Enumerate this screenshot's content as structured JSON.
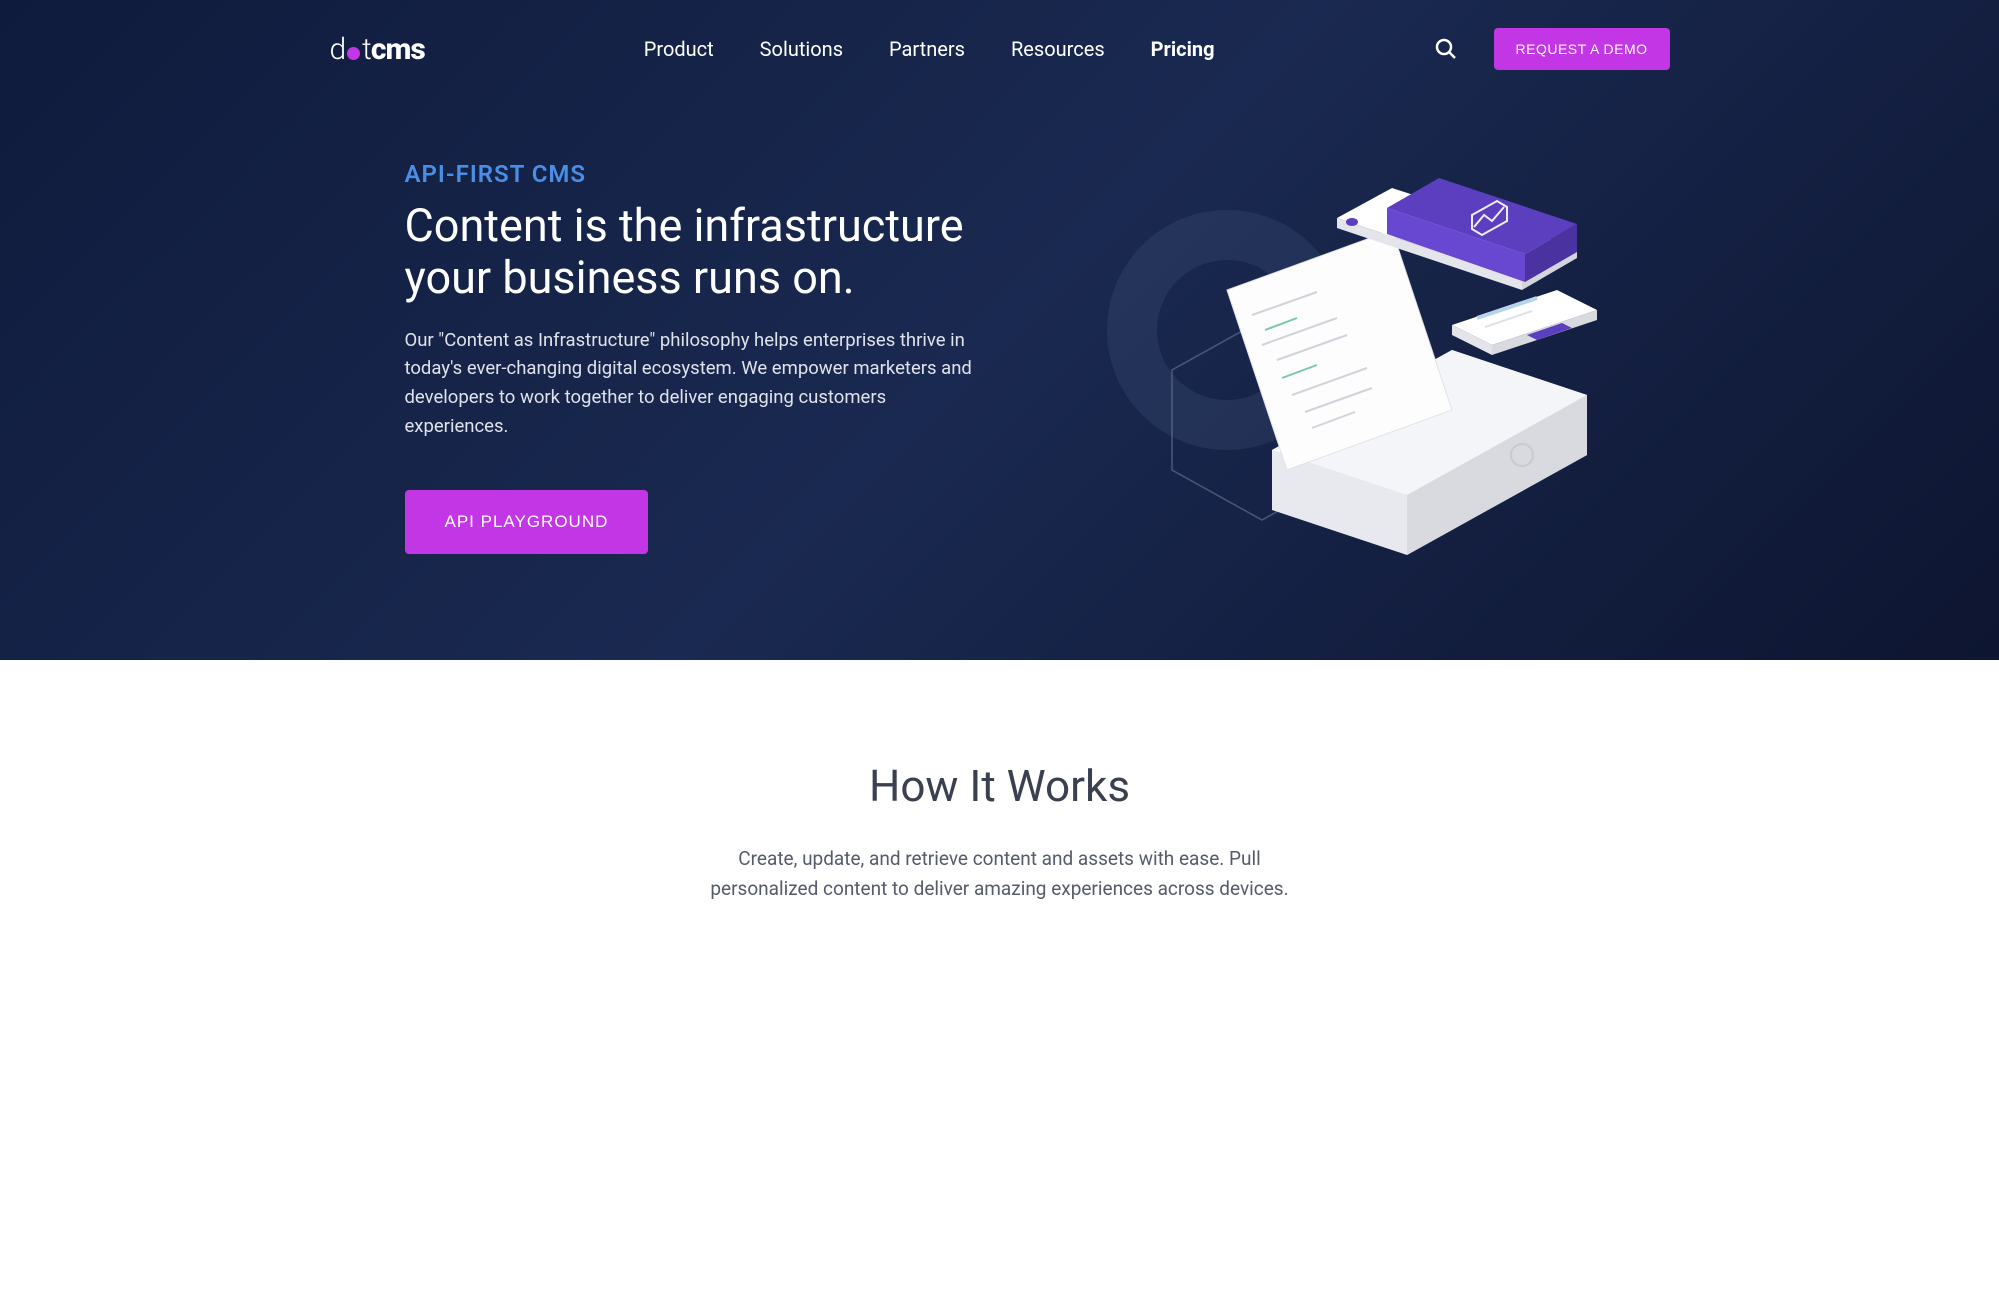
{
  "logo": {
    "prefix_d": "d",
    "prefix_t": "t",
    "suffix": "cms"
  },
  "nav": {
    "items": [
      {
        "label": "Product",
        "active": false
      },
      {
        "label": "Solutions",
        "active": false
      },
      {
        "label": "Partners",
        "active": false
      },
      {
        "label": "Resources",
        "active": false
      },
      {
        "label": "Pricing",
        "active": true
      }
    ],
    "demo_button": "REQUEST A DEMO"
  },
  "hero": {
    "eyebrow": "API-FIRST CMS",
    "title": "Content is the infrastructure your business runs on.",
    "description": "Our \"Content as Infrastructure\" philosophy helps enterprises thrive in today's ever-changing digital ecosystem. We empower marketers and developers to work together to deliver engaging customers experiences.",
    "cta_label": "API PLAYGROUND"
  },
  "section_two": {
    "title": "How It Works",
    "description": "Create, update, and retrieve content and assets with ease. Pull personalized content to deliver amazing experiences across devices."
  },
  "colors": {
    "accent": "#c336e5",
    "link_blue": "#4a8fe7",
    "hero_bg_start": "#0f1b3c",
    "hero_bg_end": "#0d1530"
  }
}
